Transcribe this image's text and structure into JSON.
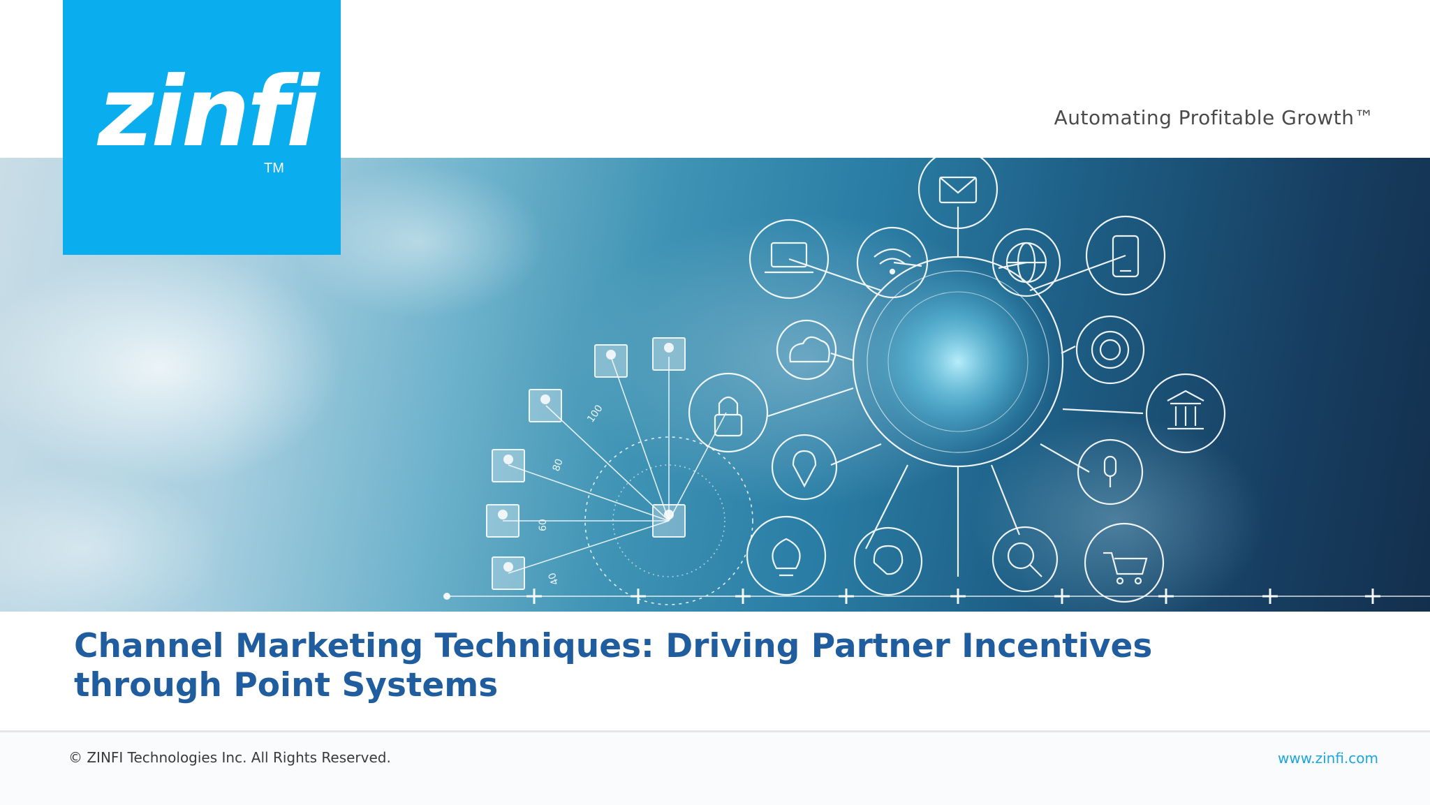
{
  "logo": {
    "text": "zinfi",
    "tm": "TM"
  },
  "tagline": "Automating Profitable Growth™",
  "hero": {
    "icons": [
      "mail-icon",
      "laptop-icon",
      "wifi-icon",
      "globe-icon",
      "tablet-icon",
      "cloud-icon",
      "gear-icon",
      "lock-icon",
      "bank-icon",
      "location-pin-icon",
      "microphone-icon",
      "lightbulb-icon",
      "brain-icon",
      "search-chart-icon",
      "shopping-cart-icon",
      "user-icon"
    ],
    "gauge_labels": [
      "100",
      "80",
      "60",
      "40"
    ]
  },
  "title": {
    "line1": "Channel Marketing Techniques: Driving Partner Incentives",
    "line2": "through Point Systems"
  },
  "footer": {
    "copyright": "© ZINFI Technologies Inc. All Rights Reserved.",
    "website": "www.zinfi.com"
  },
  "colors": {
    "brand_blue": "#0aaeef",
    "title_blue": "#1f5d9f",
    "link_blue": "#1aa5e0"
  }
}
